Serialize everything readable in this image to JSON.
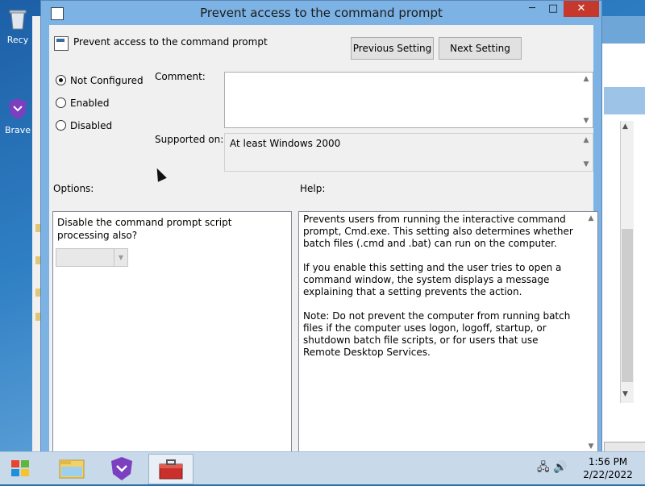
{
  "desktop": {
    "icons": [
      {
        "label": "Recy",
        "icon": "recycle-bin-icon"
      },
      {
        "label": "Brave",
        "icon": "brave-icon"
      }
    ]
  },
  "dialog": {
    "title": "Prevent access to the command prompt",
    "policy_title": "Prevent access to the command prompt",
    "previous_label": "Previous Setting",
    "next_label": "Next Setting",
    "state": {
      "options": [
        "Not Configured",
        "Enabled",
        "Disabled"
      ],
      "selected": "Not Configured"
    },
    "comment_label": "Comment:",
    "comment_value": "",
    "supported_label": "Supported on:",
    "supported_value": "At least Windows 2000",
    "options_label": "Options:",
    "help_label": "Help:",
    "option_prompt": "Disable the command prompt script processing also?",
    "option_dropdown_value": "",
    "help_paragraphs": [
      "Prevents users from running the interactive command prompt, Cmd.exe. This setting also determines whether batch files (.cmd and .bat) can run on the computer.",
      "If you enable this setting and the user tries to open a command window, the system displays a message explaining that a setting prevents the action.",
      "Note: Do not prevent the computer from running batch files if the computer uses logon, logoff, startup, or shutdown batch file scripts, or for users that use Remote Desktop Services."
    ]
  },
  "taskbar": {
    "start": "windows-start-icon",
    "items": [
      {
        "icon": "file-explorer-icon",
        "active": false
      },
      {
        "icon": "brave-icon",
        "active": false
      },
      {
        "icon": "toolbox-icon",
        "active": true
      }
    ],
    "time": "1:56 PM",
    "date": "2/22/2022"
  },
  "colors": {
    "accent": "#7cb2e4",
    "close_button": "#c7382c"
  }
}
